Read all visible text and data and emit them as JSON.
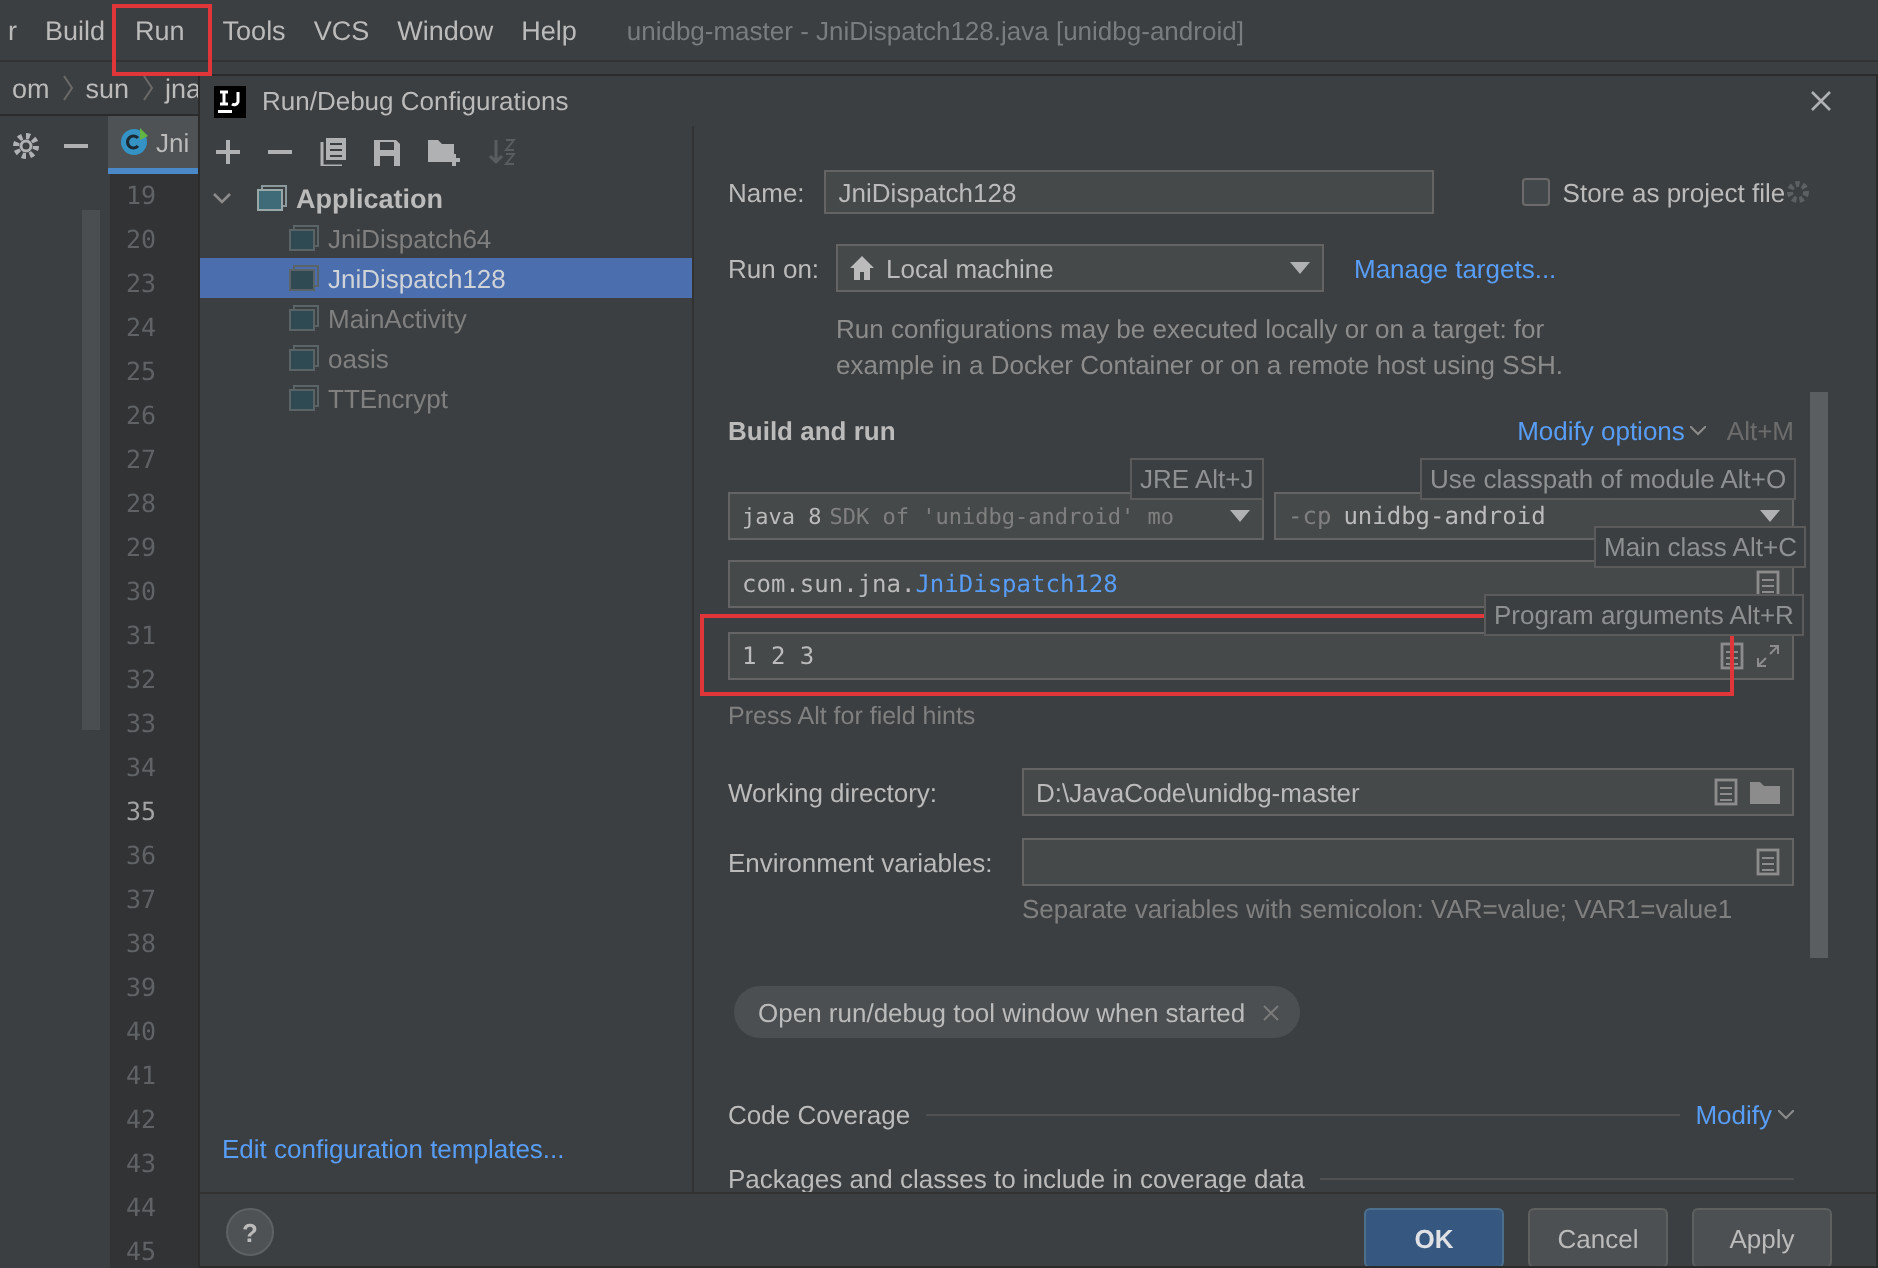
{
  "menu_bar": {
    "items": [
      {
        "label": "r",
        "highlighted": false
      },
      {
        "label": "Build",
        "highlighted": false
      },
      {
        "label": "Run",
        "highlighted": true
      },
      {
        "label": "Tools",
        "highlighted": false
      },
      {
        "label": "VCS",
        "highlighted": false
      },
      {
        "label": "Window",
        "highlighted": false
      },
      {
        "label": "Help",
        "highlighted": false
      }
    ],
    "title": "unidbg-master - JniDispatch128.java [unidbg-android]"
  },
  "breadcrumbs": [
    "om",
    "sun",
    "jna"
  ],
  "editor": {
    "tab": "Jni",
    "lines": [
      {
        "number": "19",
        "current": false
      },
      {
        "number": "20",
        "current": false
      },
      {
        "number": "23",
        "current": false
      },
      {
        "number": "24",
        "current": false
      },
      {
        "number": "25",
        "current": false
      },
      {
        "number": "26",
        "current": false
      },
      {
        "number": "27",
        "current": false
      },
      {
        "number": "28",
        "current": false
      },
      {
        "number": "29",
        "current": false
      },
      {
        "number": "30",
        "current": false
      },
      {
        "number": "31",
        "current": false
      },
      {
        "number": "32",
        "current": false
      },
      {
        "number": "33",
        "current": false
      },
      {
        "number": "34",
        "current": false
      },
      {
        "number": "35",
        "current": true
      },
      {
        "number": "36",
        "current": false
      },
      {
        "number": "37",
        "current": false
      },
      {
        "number": "38",
        "current": false
      },
      {
        "number": "39",
        "current": false
      },
      {
        "number": "40",
        "current": false
      },
      {
        "number": "41",
        "current": false
      },
      {
        "number": "42",
        "current": false
      },
      {
        "number": "43",
        "current": false
      },
      {
        "number": "44",
        "current": false
      },
      {
        "number": "45",
        "current": false
      }
    ]
  },
  "dialog": {
    "title": "Run/Debug Configurations",
    "tree": {
      "label": "Application",
      "expanded": true,
      "children": [
        {
          "label": "JniDispatch64",
          "selected": false
        },
        {
          "label": "JniDispatch128",
          "selected": true
        },
        {
          "label": "MainActivity",
          "selected": false
        },
        {
          "label": "oasis",
          "selected": false
        },
        {
          "label": "TTEncrypt",
          "selected": false
        }
      ]
    },
    "templates_link": "Edit configuration templates...",
    "help": "?",
    "form": {
      "name_label": "Name:",
      "name": "JniDispatch128",
      "store_label": "Store as project file",
      "store_checked": false,
      "run_on_label": "Run on:",
      "run_on": "Local machine",
      "manage_link": "Manage targets...",
      "description": "Run configurations may be executed locally or on a target: for example in a Docker Container or on a remote host using SSH.",
      "section": "Build and run",
      "modify_options": "Modify options",
      "modify_shortcut": "Alt+M",
      "jre": {
        "version": "java 8",
        "detail": "SDK of 'unidbg-android' mo"
      },
      "classpath": {
        "prefix": "-cp",
        "module": "unidbg-android"
      },
      "main_class": {
        "package": "com.sun.jna.",
        "class": "JniDispatch128"
      },
      "program_args": {
        "value": "1 2 3",
        "highlighted": true
      },
      "field_hint": "Press Alt for field hints",
      "working_dir_label": "Working directory:",
      "working_dir": "D:\\JavaCode\\unidbg-master",
      "env_label": "Environment variables:",
      "env_hint": "Separate variables with semicolon: VAR=value; VAR1=value1",
      "chip": "Open run/debug tool window when started",
      "coverage": "Code Coverage",
      "coverage_modify": "Modify",
      "packages": "Packages and classes to include in coverage data"
    },
    "tooltips": [
      {
        "text": "JRE Alt+J"
      },
      {
        "text": "Use classpath of module Alt+O"
      },
      {
        "text": "Main class Alt+C"
      },
      {
        "text": "Program arguments Alt+R"
      }
    ],
    "buttons": [
      {
        "label": "OK",
        "default": true
      },
      {
        "label": "Cancel",
        "default": false
      },
      {
        "label": "Apply",
        "default": false
      }
    ]
  }
}
